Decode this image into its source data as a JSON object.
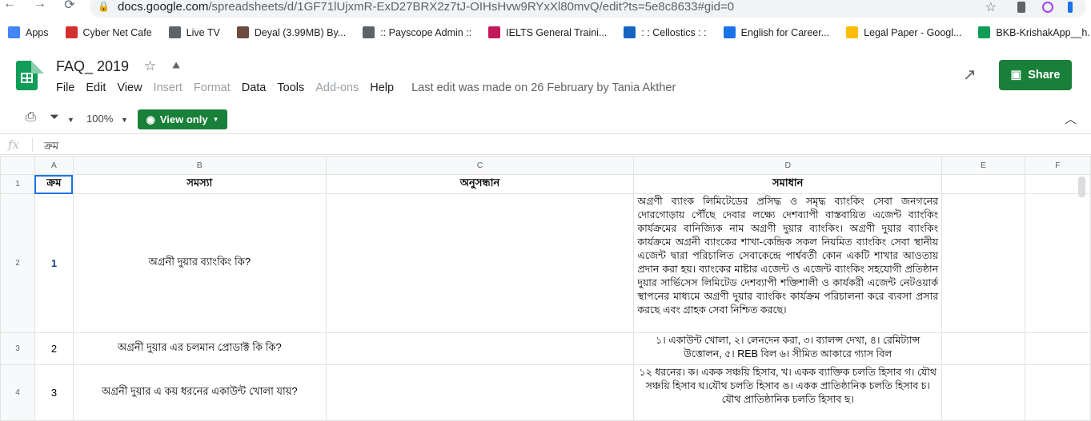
{
  "browser": {
    "url_host": "docs.google.com",
    "url_path": "/spreadsheets/d/1GF71lUjxmR-ExD27BRX2z7tJ-OIHsHvw9RYxXl80mvQ/edit?ts=5e8c8633#gid=0"
  },
  "bookmarks": [
    {
      "label": "Apps",
      "icon": "apps-grid-icon",
      "color": "#4285f4"
    },
    {
      "label": "Cyber Net Cafe",
      "icon": "cafe-icon",
      "color": "#d32f2f"
    },
    {
      "label": "Live TV",
      "icon": "globe-icon",
      "color": "#5f6368"
    },
    {
      "label": "Deyal (3.99MB) By...",
      "icon": "deyal-icon",
      "color": "#6d4c41"
    },
    {
      "label": ":: Payscope Admin ::",
      "icon": "globe-icon",
      "color": "#5f6368"
    },
    {
      "label": "IELTS General Traini...",
      "icon": "ielts-icon",
      "color": "#c2185b"
    },
    {
      "label": ": : Cellostics : :",
      "icon": "cellostics-icon",
      "color": "#1565c0"
    },
    {
      "label": "English for Career...",
      "icon": "link-icon",
      "color": "#1a73e8"
    },
    {
      "label": "Legal Paper - Googl...",
      "icon": "drive-icon",
      "color": "#fbbc04"
    },
    {
      "label": "BKB-KrishakApp__h...",
      "icon": "spreadsheet-icon",
      "color": "#0f9d58"
    }
  ],
  "doc": {
    "title": "FAQ_ 2019",
    "menus": [
      {
        "label": "File",
        "enabled": true
      },
      {
        "label": "Edit",
        "enabled": true
      },
      {
        "label": "View",
        "enabled": true
      },
      {
        "label": "Insert",
        "enabled": false
      },
      {
        "label": "Format",
        "enabled": false
      },
      {
        "label": "Data",
        "enabled": true
      },
      {
        "label": "Tools",
        "enabled": true
      },
      {
        "label": "Add-ons",
        "enabled": false
      },
      {
        "label": "Help",
        "enabled": true
      }
    ],
    "last_edit": "Last edit was made on 26 February by Tania Akther",
    "share_label": "Share",
    "accent": "#188038"
  },
  "toolbar": {
    "zoom": "100%",
    "view_only_label": "View only"
  },
  "formula_bar": {
    "fx": "fx",
    "value": "ক্রম"
  },
  "sheet": {
    "columns": [
      "A",
      "B",
      "C",
      "D",
      "E",
      "F"
    ],
    "rows": [
      {
        "num": "1",
        "cells": [
          "ক্রম",
          "সমস্যা",
          "অনুসন্ধান",
          "সমাধান",
          "",
          ""
        ]
      },
      {
        "num": "2",
        "cells": [
          "1",
          "অগ্রনী দুয়ার ব্যাংকিং কি?",
          "",
          "অগ্রণী ব্যাংক লিমিটেডের প্রসিদ্ধ ও সমৃদ্ধ ব্যাংকিং সেবা জনগনের দোরগোড়ায় পৌঁছে দেবার লক্ষ্যে দেশব্যাপী বাস্তবায়িত এজেন্ট ব্যাংকিং কার্যক্রমের বানিজ্যিক নাম অগ্রণী দুয়ার ব্যাংকিং। অগ্রণী দুয়ার ব্যাংকিং কার্যক্রমে অগ্রনী ব্যাংকের শাখা-কেন্দ্রিক সকল নিয়মিত ব্যাংকিং সেবা স্থানীয় এজেন্ট দ্বারা পরিচালিত সেবাকেন্দ্রে পার্শ্ববর্তী কোন একটি শাখার আওতায় প্রদান করা হয়। ব্যাংকের মাষ্টার এজেন্ট ও এজেন্ট ব্যাংকিং সহযোগী প্রতিষ্ঠান দুয়ার সার্ভিসেস লিমিটেড দেশব্যাপী শক্তিশালী ও কার্যকরী এজেন্ট নেটওয়ার্ক স্থাপনের মাধ্যমে অগ্রণী দুয়ার ব্যাংকিং কার্যক্রম পরিচালনা করে ব্যবসা প্রসার করছে এবং গ্রাহক সেবা নিশ্চিত করছে।",
          "",
          ""
        ]
      },
      {
        "num": "3",
        "cells": [
          "2",
          "অগ্রনী দুয়ার এর চলমান প্রোডাক্ট কি কি?",
          "",
          "১। একাউন্ট খোলা, ২। লেনদেন করা, ৩। ব্যালন্স দেখা, ৪। রেমিট্যান্স উত্তোলন, ৫। REB বিল ৬। সীমিত আকারে গ্যাস বিল",
          "",
          ""
        ]
      },
      {
        "num": "4",
        "cells": [
          "3",
          "অগ্রনী দুয়ার এ কয় ধরনের একাউন্ট খোলা যায়?",
          "",
          "১২ ধরনের। ক। একক সঞ্চয়ি হিসাব, খ। একক ব্যাক্তিক চলতি হিসাব গ। যৌথ সঞ্চয়ি হিসাব ঘ।যৌথ চলতি হিসাব ঙ। একক প্রাতিষ্ঠানিক চলতি হিসাব চ।যৌথ প্রাতিষ্ঠানিক চলতি হিসাব ছ।",
          "",
          ""
        ]
      }
    ]
  }
}
